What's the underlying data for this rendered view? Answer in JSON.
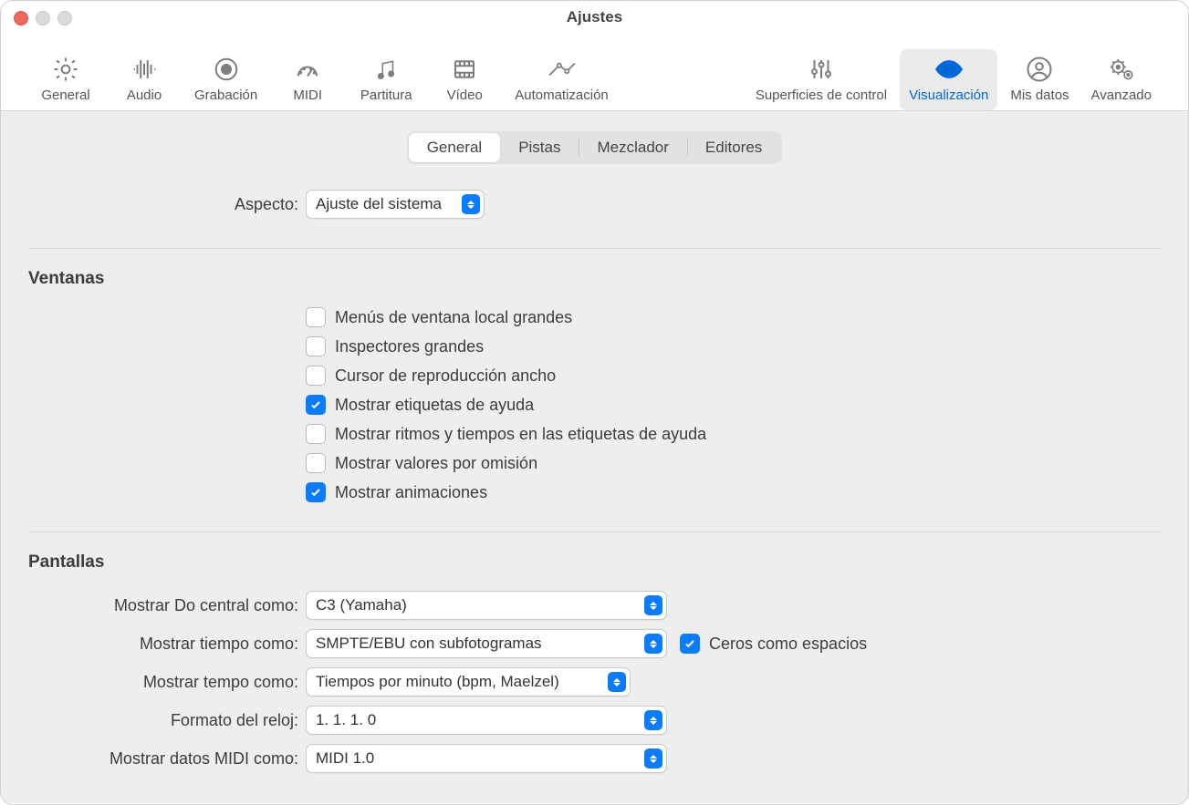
{
  "window": {
    "title": "Ajustes"
  },
  "toolbar": {
    "items": [
      {
        "id": "general",
        "label": "General"
      },
      {
        "id": "audio",
        "label": "Audio"
      },
      {
        "id": "recording",
        "label": "Grabación"
      },
      {
        "id": "midi",
        "label": "MIDI"
      },
      {
        "id": "score",
        "label": "Partitura"
      },
      {
        "id": "video",
        "label": "Vídeo"
      },
      {
        "id": "automation",
        "label": "Automatización"
      },
      {
        "id": "controlsurfaces",
        "label": "Superficies de control"
      },
      {
        "id": "display",
        "label": "Visualización"
      },
      {
        "id": "mydata",
        "label": "Mis datos"
      },
      {
        "id": "advanced",
        "label": "Avanzado"
      }
    ],
    "active": "display"
  },
  "segmented": {
    "items": [
      {
        "id": "general",
        "label": "General"
      },
      {
        "id": "tracks",
        "label": "Pistas"
      },
      {
        "id": "mixer",
        "label": "Mezclador"
      },
      {
        "id": "editors",
        "label": "Editores"
      }
    ],
    "active": "general"
  },
  "appearance": {
    "label": "Aspecto:",
    "value": "Ajuste del sistema"
  },
  "windows": {
    "title": "Ventanas",
    "options": [
      {
        "id": "large_local_menus",
        "label": "Menús de ventana local grandes",
        "checked": false
      },
      {
        "id": "large_inspectors",
        "label": "Inspectores grandes",
        "checked": false
      },
      {
        "id": "wide_playhead",
        "label": "Cursor de reproducción ancho",
        "checked": false
      },
      {
        "id": "show_tooltips",
        "label": "Mostrar etiquetas de ayuda",
        "checked": true
      },
      {
        "id": "show_beats_times",
        "label": "Mostrar ritmos y tiempos en las etiquetas de ayuda",
        "checked": false
      },
      {
        "id": "show_defaults",
        "label": "Mostrar valores por omisión",
        "checked": false
      },
      {
        "id": "show_animations",
        "label": "Mostrar animaciones",
        "checked": true
      }
    ]
  },
  "displays": {
    "title": "Pantallas",
    "rows": {
      "middle_c": {
        "label": "Mostrar Do central como:",
        "value": "C3 (Yamaha)"
      },
      "time_as": {
        "label": "Mostrar tiempo como:",
        "value": "SMPTE/EBU con subfotogramas"
      },
      "zeros": {
        "label": "Ceros como espacios",
        "checked": true
      },
      "tempo_as": {
        "label": "Mostrar tempo como:",
        "value": "Tiempos por minuto (bpm, Maelzel)"
      },
      "clock_fmt": {
        "label": "Formato del reloj:",
        "value": "1. 1. 1. 0"
      },
      "midi_as": {
        "label": "Mostrar datos MIDI como:",
        "value": "MIDI 1.0"
      }
    }
  }
}
